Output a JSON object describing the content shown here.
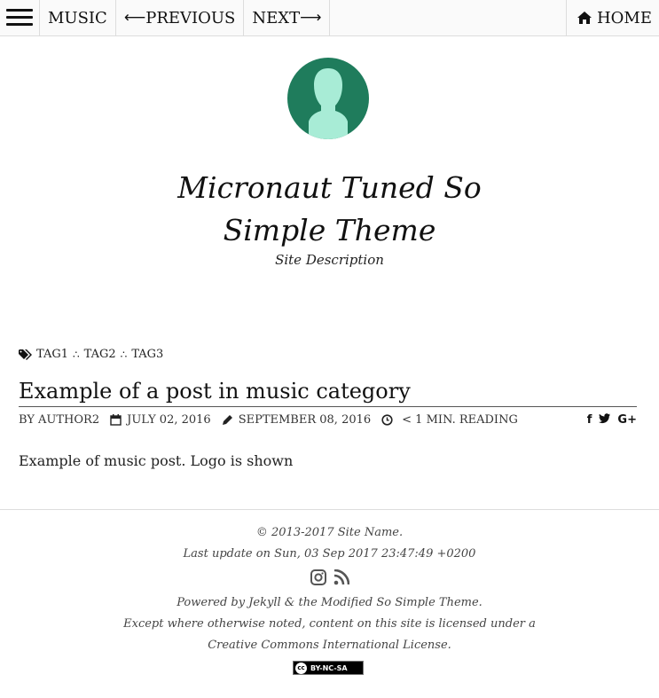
{
  "nav": {
    "category": "MUSIC",
    "previous": "PREVIOUS",
    "next": "NEXT",
    "home": "HOME"
  },
  "site": {
    "title_line1": "Micronaut Tuned So",
    "title_line2": "Simple Theme",
    "description": "Site Description"
  },
  "post": {
    "tags": [
      "TAG1",
      "TAG2",
      "TAG3"
    ],
    "tag_separator": "∴",
    "title": "Example of a post in music category",
    "author": "BY AUTHOR2",
    "published": "JULY 02, 2016",
    "updated": "SEPTEMBER 08, 2016",
    "reading_time": "< 1 MIN. READING",
    "body": "Example of music post. Logo is shown"
  },
  "footer": {
    "copyright": "© 2013-2017 Site Name.",
    "last_update": "Last update on Sun, 03 Sep 2017 23:47:49 +0200",
    "powered_by": "Powered by Jekyll & the Modified So Simple Theme.",
    "license_line1": "Except where otherwise noted, content on this site is licensed under a",
    "license_line2": "Creative Commons International License.",
    "badge_text": "BY-NC-SA"
  },
  "icons": {
    "menu": "hamburger-icon",
    "previous": "arrow-left-icon",
    "next": "arrow-right-icon",
    "home": "home-icon",
    "tags": "tags-icon",
    "published": "calendar-icon",
    "updated": "pencil-icon",
    "reading": "clock-icon",
    "share": [
      "facebook-icon",
      "twitter-icon",
      "google-plus-icon"
    ],
    "social": [
      "instagram-icon",
      "rss-icon"
    ]
  },
  "colors": {
    "avatar_bg": "#1f7c5c",
    "avatar_figure": "#a8ecd6"
  }
}
